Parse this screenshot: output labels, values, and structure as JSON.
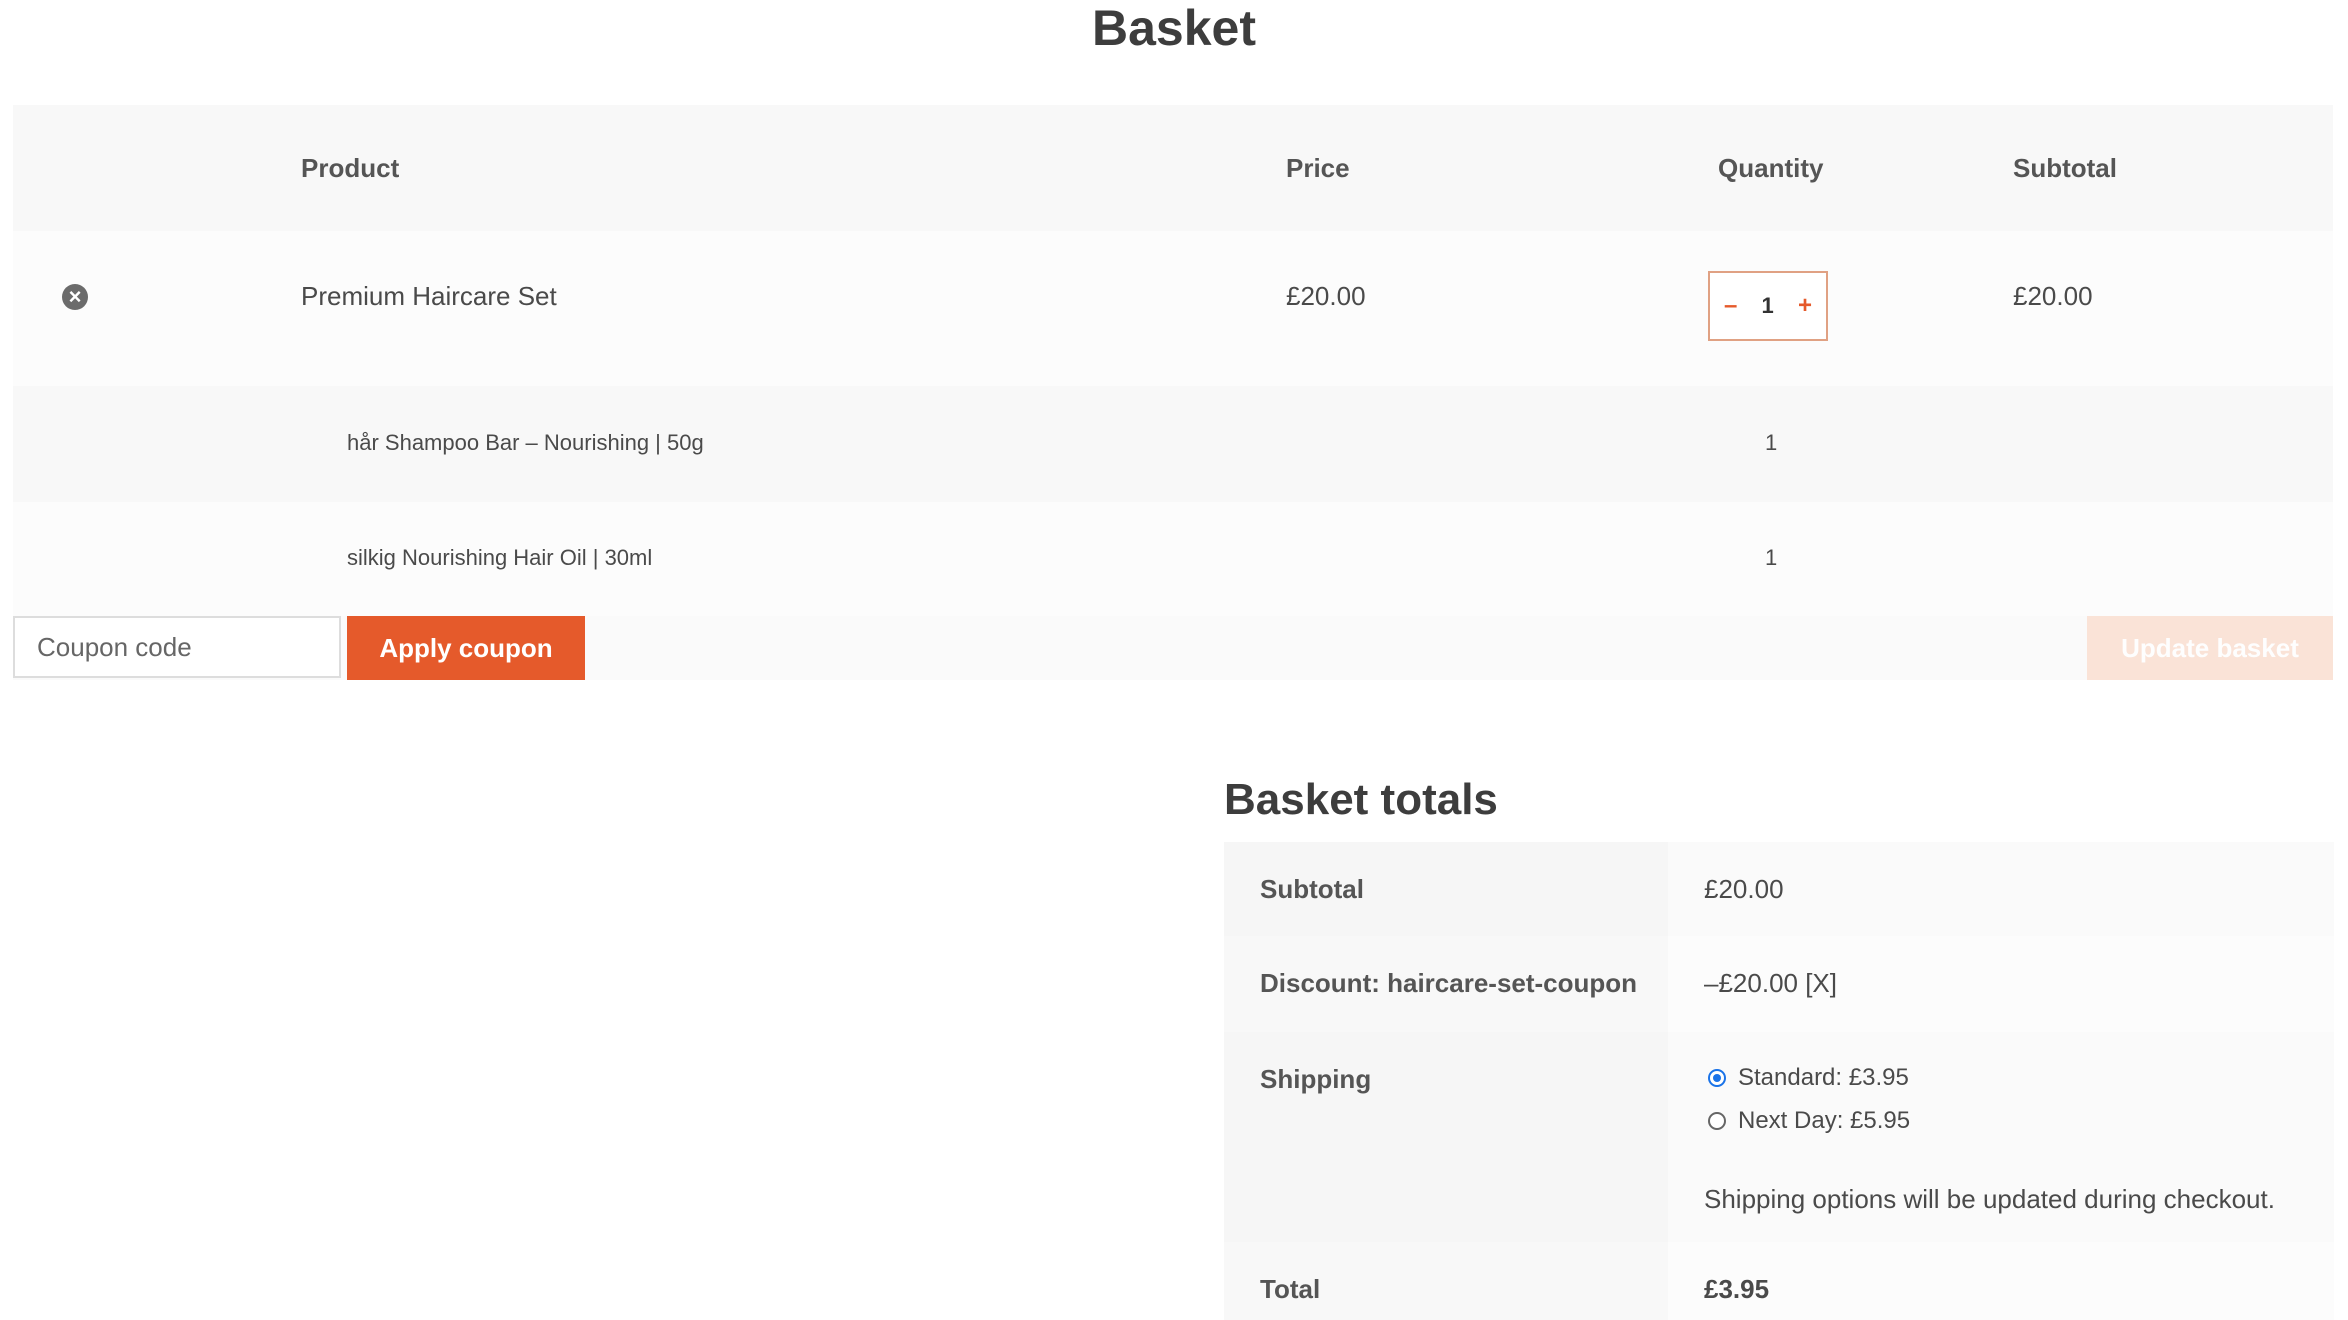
{
  "page": {
    "title": "Basket"
  },
  "cart": {
    "headers": {
      "product": "Product",
      "price": "Price",
      "quantity": "Quantity",
      "subtotal": "Subtotal"
    },
    "item": {
      "remove_icon": "×",
      "name": "Premium Haircare Set",
      "price": "£20.00",
      "quantity": "1",
      "qty_minus": "–",
      "qty_plus": "+",
      "subtotal": "£20.00"
    },
    "bundle_items": [
      {
        "name": "hår Shampoo Bar – Nourishing | 50g",
        "quantity": "1"
      },
      {
        "name": "silkig Nourishing Hair Oil | 30ml",
        "quantity": "1"
      }
    ]
  },
  "actions": {
    "coupon_placeholder": "Coupon code",
    "apply_label": "Apply coupon",
    "update_label": "Update basket"
  },
  "totals": {
    "title": "Basket totals",
    "subtotal_label": "Subtotal",
    "subtotal_value": "£20.00",
    "discount_label": "Discount: haircare-set-coupon",
    "discount_value": "–£20.00 [X]",
    "shipping_label": "Shipping",
    "shipping_options": [
      {
        "label": "Standard: £3.95",
        "selected": true
      },
      {
        "label": "Next Day: £5.95",
        "selected": false
      }
    ],
    "shipping_note": "Shipping options will be updated during checkout.",
    "total_label": "Total",
    "total_value": "£3.95"
  },
  "colors": {
    "accent": "#e55a2b",
    "accent_disabled": "#fbe2d6",
    "radio_selected": "#1a73e8"
  }
}
